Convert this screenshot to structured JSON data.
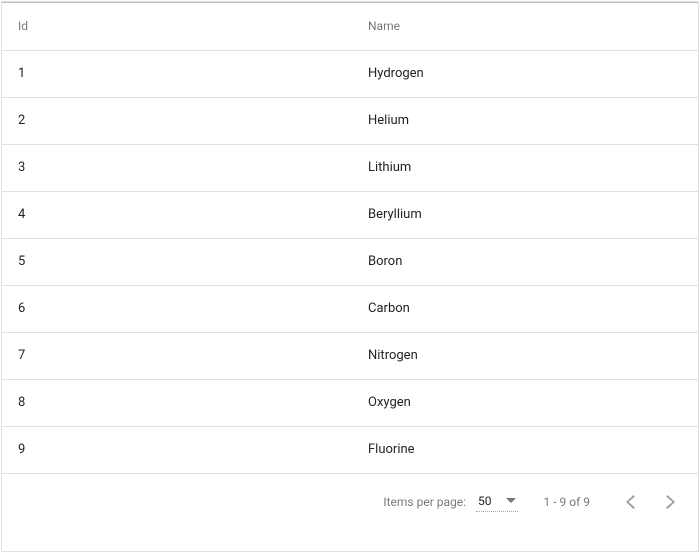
{
  "table": {
    "headers": {
      "id": "Id",
      "name": "Name"
    },
    "rows": [
      {
        "id": "1",
        "name": "Hydrogen"
      },
      {
        "id": "2",
        "name": "Helium"
      },
      {
        "id": "3",
        "name": "Lithium"
      },
      {
        "id": "4",
        "name": "Beryllium"
      },
      {
        "id": "5",
        "name": "Boron"
      },
      {
        "id": "6",
        "name": "Carbon"
      },
      {
        "id": "7",
        "name": "Nitrogen"
      },
      {
        "id": "8",
        "name": "Oxygen"
      },
      {
        "id": "9",
        "name": "Fluorine"
      }
    ]
  },
  "paginator": {
    "items_per_page_label": "Items per page:",
    "page_size": "50",
    "range_label": "1 - 9 of 9"
  }
}
